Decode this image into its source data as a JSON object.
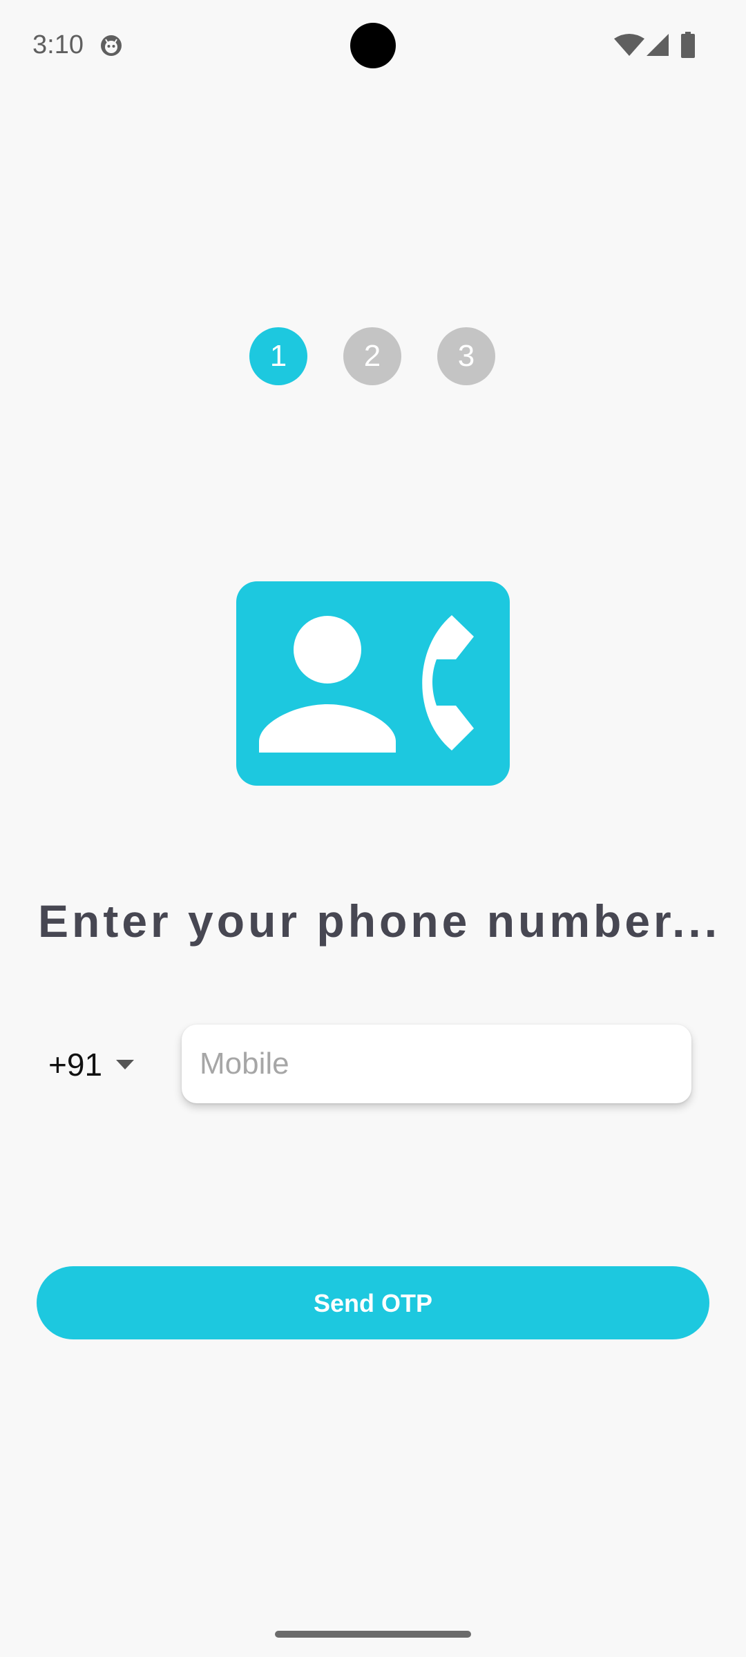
{
  "colors": {
    "accent": "#1DC8DF",
    "inactive_step": "#C4C4C4",
    "heading": "#474752",
    "background": "#F8F8F8"
  },
  "status_bar": {
    "time": "3:10",
    "icons": [
      "app-notification-icon",
      "wifi-icon",
      "signal-icon",
      "battery-icon"
    ]
  },
  "stepper": {
    "current_step": 1,
    "steps": [
      {
        "label": "1",
        "state": "active"
      },
      {
        "label": "2",
        "state": "inactive"
      },
      {
        "label": "3",
        "state": "inactive"
      }
    ]
  },
  "illustration": {
    "icon": "contact-phone-icon"
  },
  "heading": "Enter your phone number...",
  "phone_form": {
    "country_code": "+91",
    "mobile_placeholder": "Mobile",
    "mobile_value": ""
  },
  "actions": {
    "send_label": "Send OTP"
  }
}
